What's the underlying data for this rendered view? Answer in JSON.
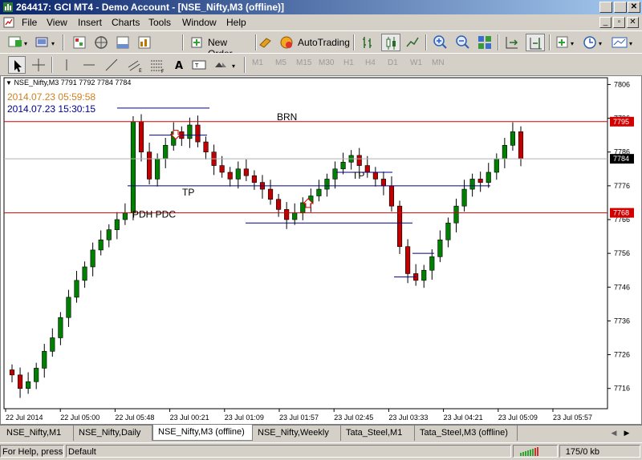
{
  "window": {
    "title": "264417: GCI MT4 - Demo Account - [NSE_Nifty,M3 (offline)]"
  },
  "menu": [
    "File",
    "View",
    "Insert",
    "Charts",
    "Tools",
    "Window",
    "Help"
  ],
  "toolbar": {
    "new_order": "New Order",
    "autotrading": "AutoTrading"
  },
  "timeframes": [
    "M1",
    "M5",
    "M15",
    "M30",
    "H1",
    "H4",
    "D1",
    "W1",
    "MN"
  ],
  "chart": {
    "header": "NSE_Nifty,M3  7791 7792 7784 7784",
    "timestamp_1": "2014.07.23 05:59:58",
    "timestamp_2": "2014.07.23 15:30:15",
    "annotations": {
      "brn": "BRN",
      "pdh_pdc": "PDH PDC",
      "tp_1": "TP",
      "tp_2": "TP"
    },
    "price_badges": {
      "upper_red": "7795",
      "current": "7784",
      "lower_red": "7768"
    },
    "colors": {
      "bull": "#008000",
      "bear": "#c00000",
      "level_line": "#d00000",
      "marker_line": "#000080"
    }
  },
  "chart_data": {
    "type": "candlestick",
    "symbol": "NSE_Nifty",
    "timeframe": "M3",
    "y_ticks": [
      7806,
      7796,
      7786,
      7776,
      7766,
      7756,
      7746,
      7736,
      7726,
      7716
    ],
    "ylim": [
      7710,
      7808
    ],
    "x_tick_labels": [
      "22 Jul 2014",
      "22 Jul 05:00",
      "22 Jul 05:48",
      "23 Jul 00:21",
      "23 Jul 01:09",
      "23 Jul 01:57",
      "23 Jul 02:45",
      "23 Jul 03:33",
      "23 Jul 04:21",
      "23 Jul 05:09",
      "23 Jul 05:57"
    ],
    "horizontal_levels": [
      {
        "label": "BRN",
        "value": 7795
      },
      {
        "label": "PDH PDC",
        "value": 7768
      }
    ],
    "current_price": 7784,
    "closes_approx": [
      7720,
      7716,
      7718,
      7722,
      7727,
      7731,
      7737,
      7743,
      7748,
      7752,
      7757,
      7760,
      7763,
      7766,
      7768,
      7795,
      7786,
      7778,
      7784,
      7788,
      7792,
      7790,
      7794,
      7789,
      7786,
      7782,
      7780,
      7778,
      7781,
      7779,
      7777,
      7775,
      7772,
      7769,
      7766,
      7768,
      7771,
      7773,
      7775,
      7778,
      7781,
      7783,
      7785,
      7782,
      7780,
      7778,
      7776,
      7770,
      7758,
      7750,
      7748,
      7751,
      7755,
      7760,
      7765,
      7770,
      7775,
      7778,
      7777,
      7780,
      7784,
      7788,
      7792,
      7784
    ]
  },
  "tabs": [
    "NSE_Nifty,M1",
    "NSE_Nifty,Daily",
    "NSE_Nifty,M3 (offline)",
    "NSE_Nifty,Weekly",
    "Tata_Steel,M1",
    "Tata_Steel,M3 (offline)"
  ],
  "status": {
    "help": "For Help, press F1",
    "profile": "Default",
    "traffic": "175/0 kb"
  }
}
